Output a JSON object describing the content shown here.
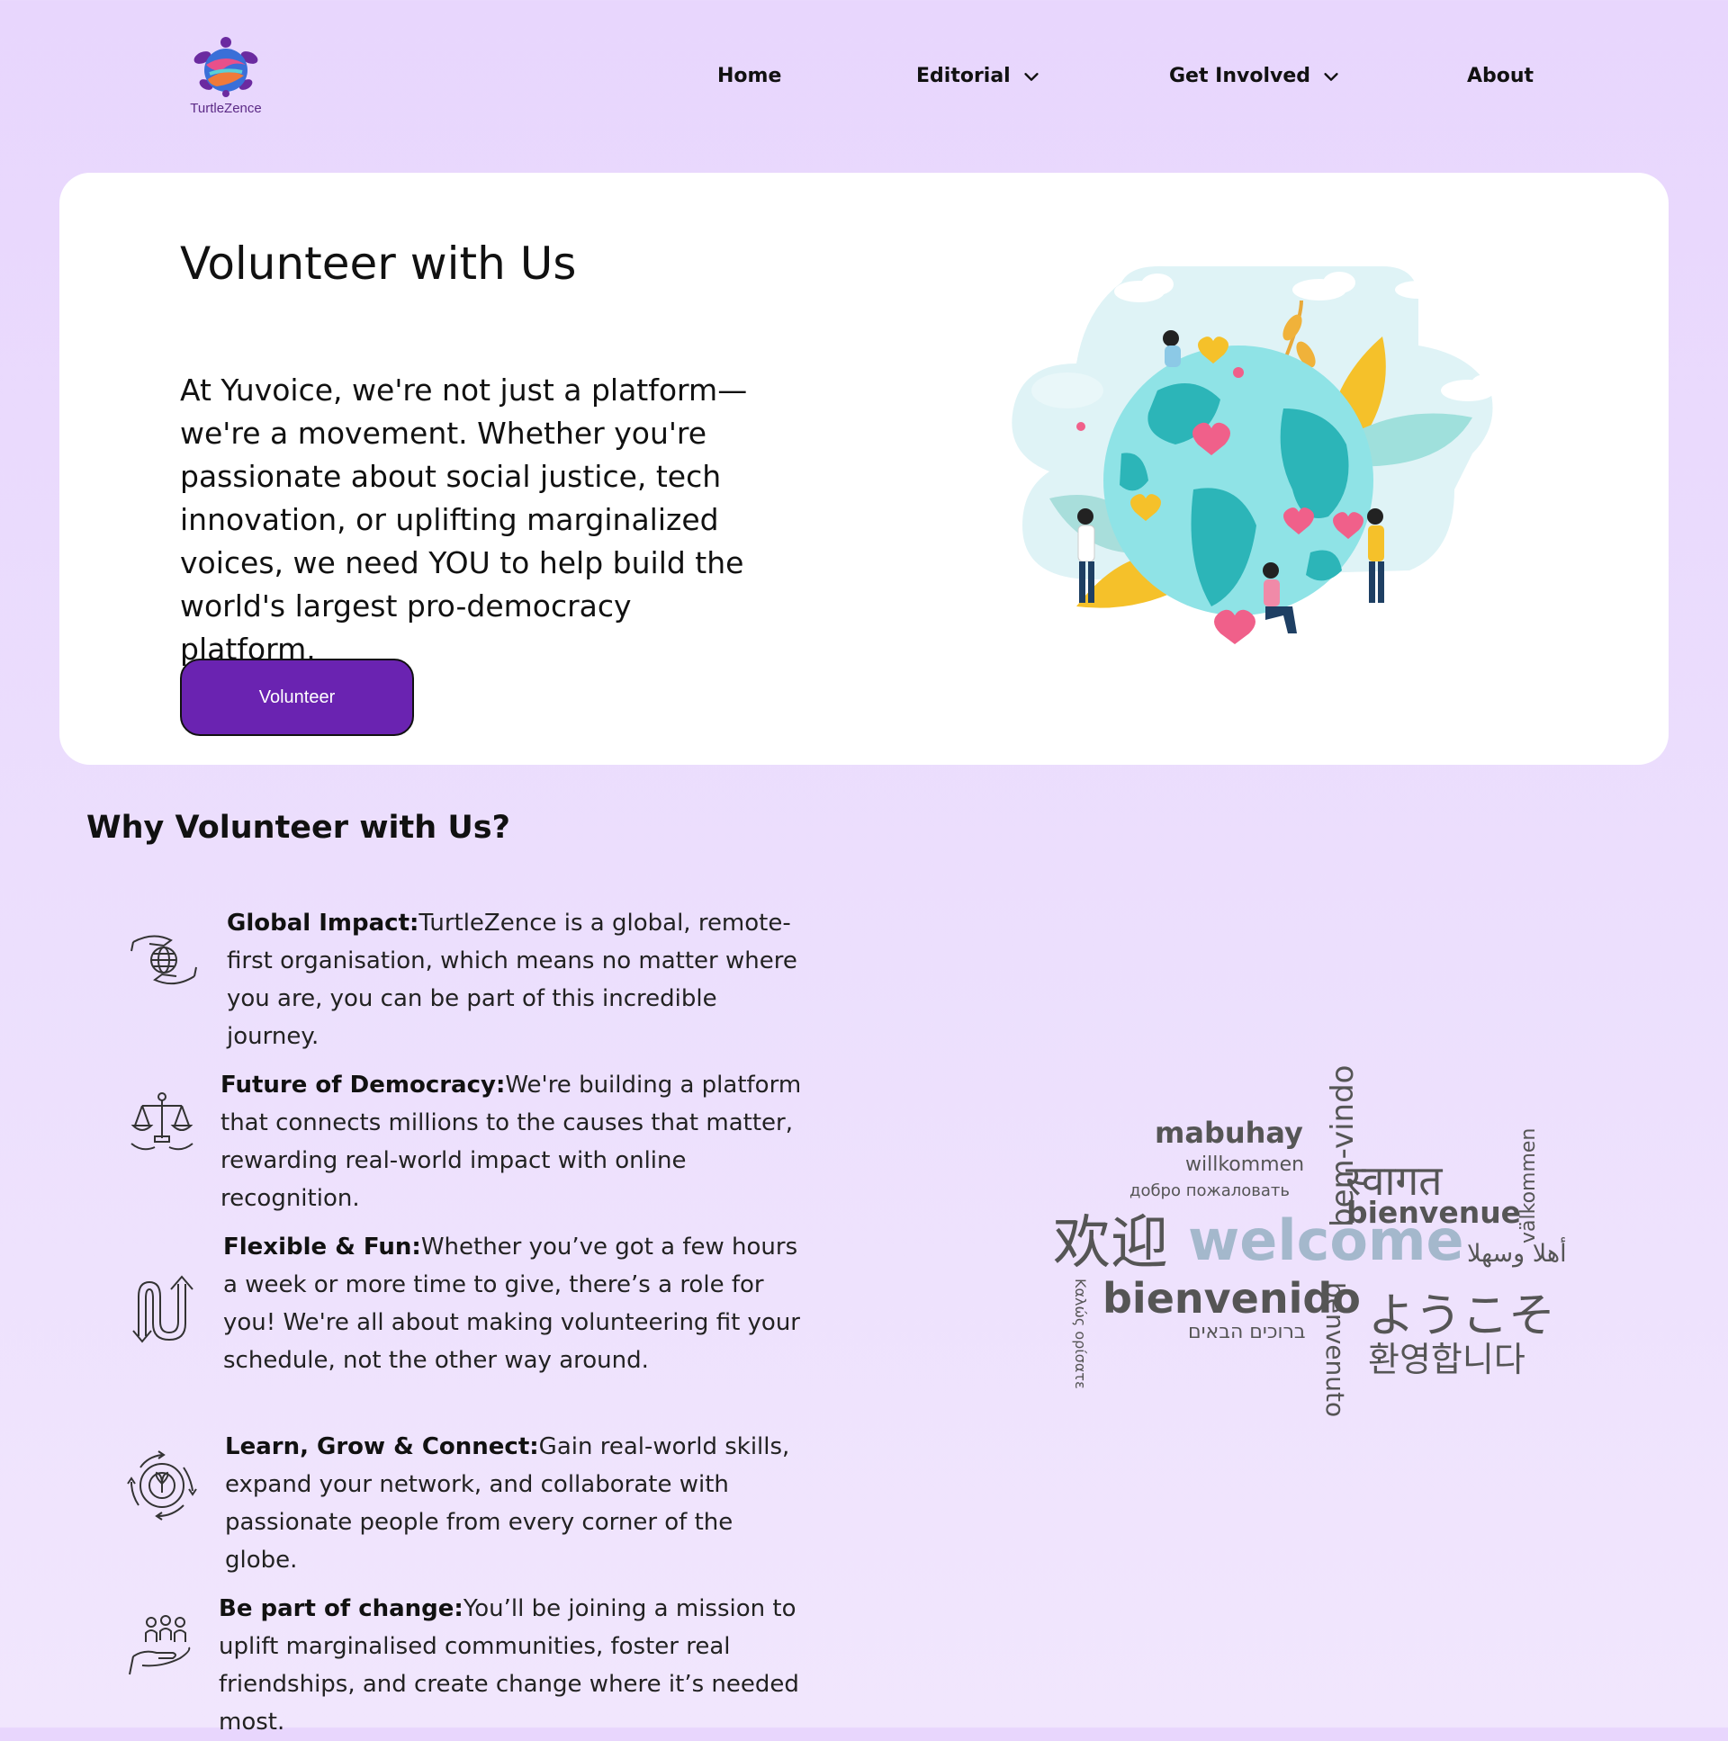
{
  "brand": {
    "name": "TurtleZence",
    "logo_icon": "turtle-logo-icon"
  },
  "nav": {
    "home": "Home",
    "editorial": "Editorial",
    "get_involved": "Get Involved",
    "about": "About"
  },
  "hero": {
    "title": "Volunteer with Us",
    "text": "At Yuvoice, we're not just a platform—we're a movement. Whether you're passionate about social justice, tech innovation, or uplifting marginalized voices, we need YOU to help build the world's largest pro-democracy platform.",
    "button": "Volunteer",
    "illustration": "people-around-globe-illustration"
  },
  "why": {
    "title": "Why Volunteer with Us?",
    "items": [
      {
        "icon": "hands-globe-icon",
        "title": "Global Impact:",
        "text": "TurtleZence is a global, remote-first organisation, which means no matter where you are, you can be part of this incredible journey."
      },
      {
        "icon": "scales-hands-icon",
        "title": "Future of Democracy:",
        "text": "We're building a platform that connects millions to the causes that matter, rewarding real-world impact with online recognition."
      },
      {
        "icon": "flexible-arrows-icon",
        "title": "Flexible & Fun:",
        "text": "Whether you’ve got a few hours a week or more time to give, there’s a role for you! We're all about making volunteering fit your schedule, not the other way around."
      },
      {
        "icon": "growth-circle-icon",
        "title": "Learn, Grow & Connect:",
        "text": "Gain real-world skills, expand your network, and collaborate with passionate people from every corner of the globe."
      },
      {
        "icon": "people-hand-icon",
        "title": "Be part of change:",
        "text": "You’ll be joining a mission to uplift marginalised communities, foster real friendships, and create change where it’s needed most."
      }
    ]
  },
  "word_cloud": {
    "words": [
      "mabuhay",
      "willkommen",
      "добро пожаловать",
      "bem-vindo",
      "स्वागत",
      "välkommen",
      "bienvenue",
      "欢迎",
      "welcome",
      "أهلا وسهلا",
      "bienvenido",
      "Καλώς ορίσατε",
      "ברוכים הבאים",
      "benvenuto",
      "ようこそ",
      "환영합니다"
    ]
  }
}
